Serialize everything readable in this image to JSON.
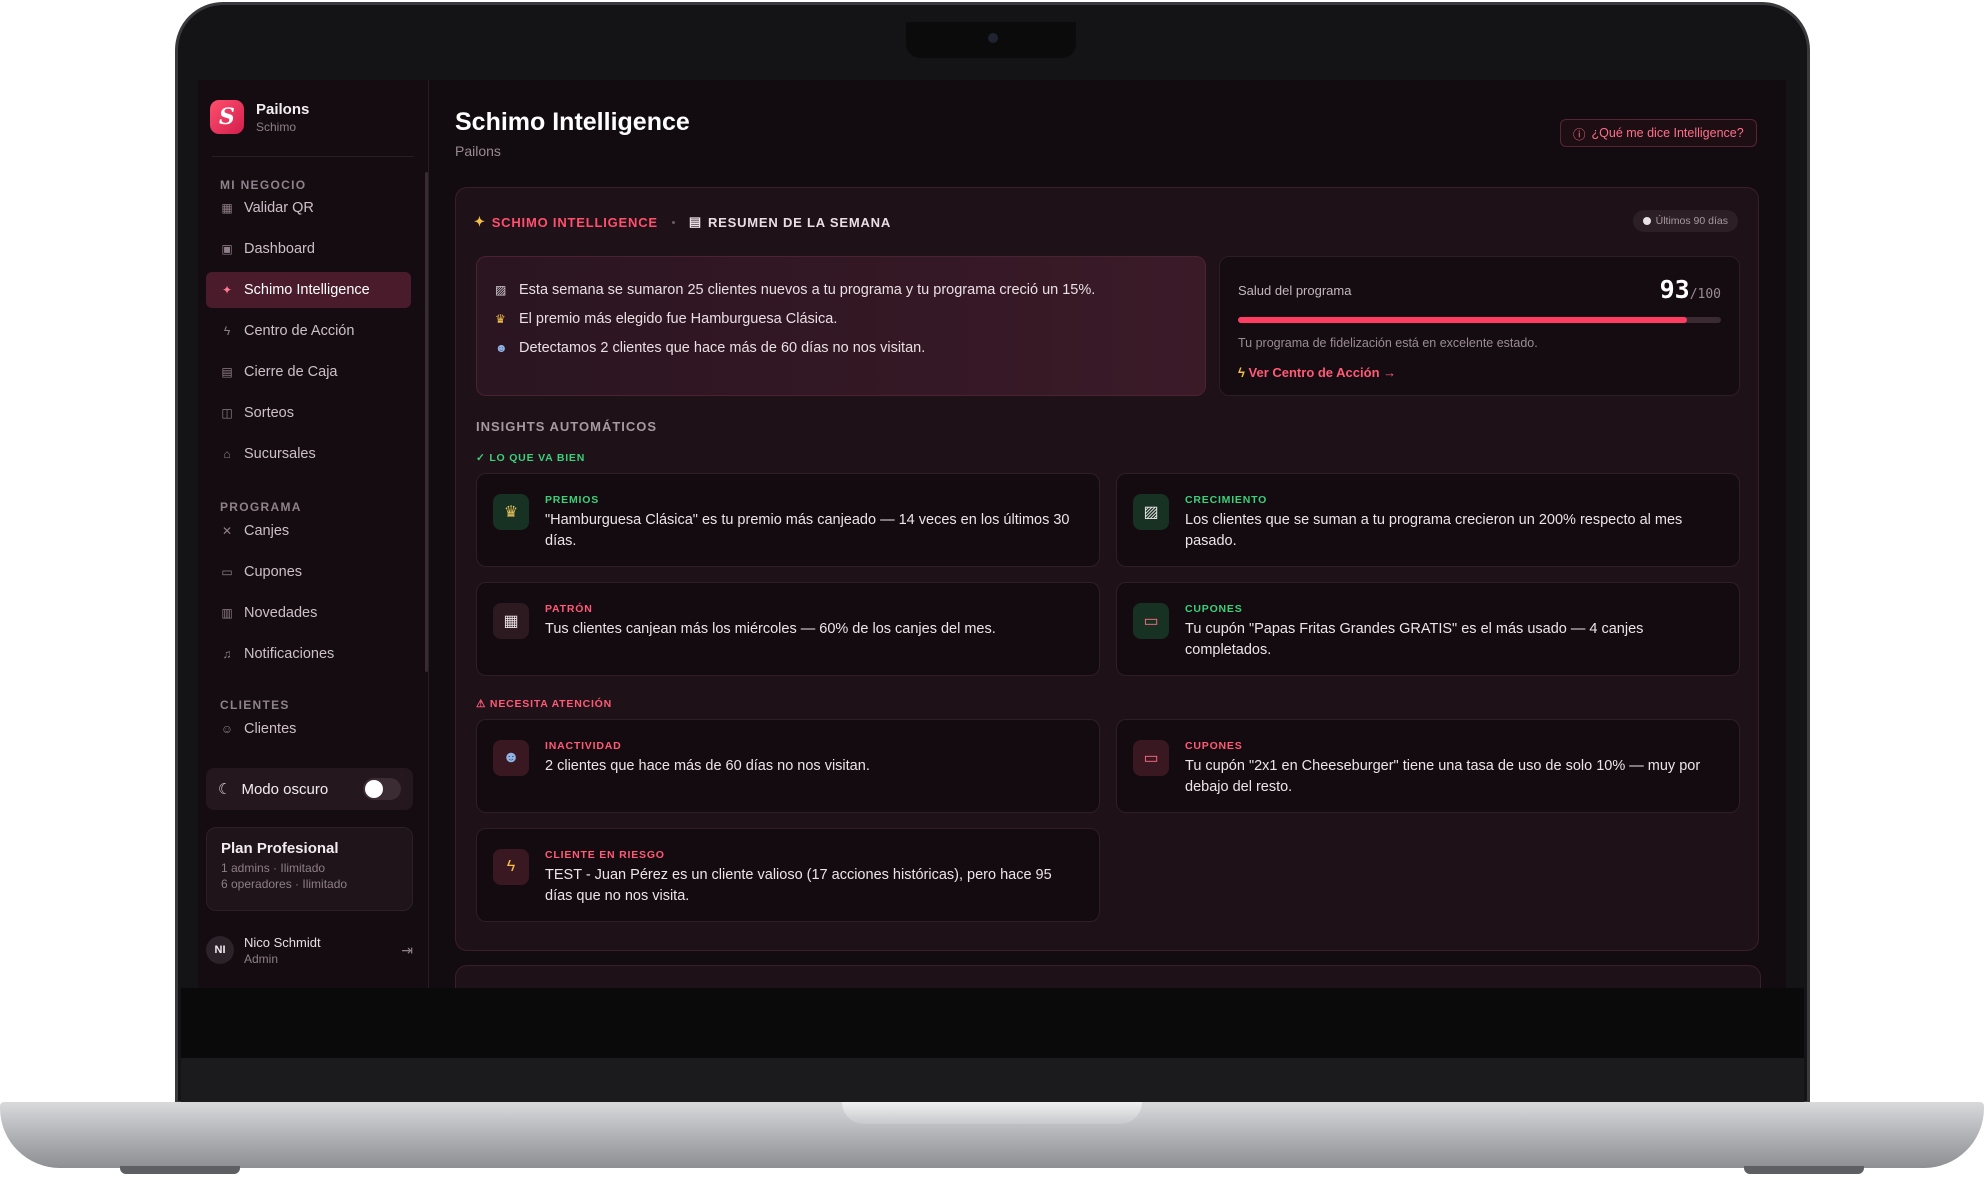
{
  "sidebar": {
    "brand_name": "Pailons",
    "brand_sub": "Schimo",
    "sections": {
      "negocio": "MI NEGOCIO",
      "programa": "PROGRAMA",
      "clientes": "CLIENTES"
    },
    "items": [
      {
        "label": "Validar QR",
        "icon": "qr-icon"
      },
      {
        "label": "Dashboard",
        "icon": "dashboard-icon"
      },
      {
        "label": "Schimo Intelligence",
        "icon": "sparkle-icon",
        "active": true
      },
      {
        "label": "Centro de Acción",
        "icon": "bolt-icon"
      },
      {
        "label": "Cierre de Caja",
        "icon": "cash-icon"
      },
      {
        "label": "Sorteos",
        "icon": "gift-icon"
      },
      {
        "label": "Sucursales",
        "icon": "store-icon"
      },
      {
        "label": "Canjes",
        "icon": "exchange-icon"
      },
      {
        "label": "Cupones",
        "icon": "ticket-icon"
      },
      {
        "label": "Novedades",
        "icon": "news-icon"
      },
      {
        "label": "Notificaciones",
        "icon": "bell-icon"
      },
      {
        "label": "Clientes",
        "icon": "users-icon"
      }
    ],
    "dark_mode_label": "Modo oscuro",
    "plan": {
      "title": "Plan Profesional",
      "line1": "1 admins · Ilimitado",
      "line2": "6 operadores · Ilimitado"
    },
    "user": {
      "initials": "NI",
      "name": "Nico Schmidt",
      "role": "Admin"
    }
  },
  "header": {
    "title": "Schimo Intelligence",
    "subtitle": "Pailons",
    "help_button": "¿Qué me dice Intelligence?"
  },
  "panel": {
    "tab_intelligence": "SCHIMO INTELLIGENCE",
    "tab_summary": "RESUMEN DE LA SEMANA",
    "period": "Últimos 90 días",
    "summary_lines": [
      "Esta semana se sumaron 25 clientes nuevos a tu programa y tu programa creció un 15%.",
      "El premio más elegido fue Hamburguesa Clásica.",
      "Detectamos 2 clientes que hace más de 60 días no nos visitan."
    ],
    "health": {
      "label": "Salud del programa",
      "score": "93",
      "max": "/100",
      "score_value": 93,
      "description": "Tu programa de fidelización está en excelente estado.",
      "link": "Ver Centro de Acción →"
    },
    "insights_title": "INSIGHTS AUTOMÁTICOS",
    "group_good": "✓ LO QUE VA BIEN",
    "group_warn": "⚠ NECESITA ATENCIÓN",
    "cards_good": [
      {
        "tag": "PREMIOS",
        "icon": "trophy-icon",
        "text": "\"Hamburguesa Clásica\" es tu premio más canjeado — 14 veces en los últimos 30 días."
      },
      {
        "tag": "CRECIMIENTO",
        "icon": "chart-icon",
        "text": "Los clientes que se suman a tu programa crecieron un 200% respecto al mes pasado."
      },
      {
        "tag": "PATRÓN",
        "icon": "calendar-icon",
        "text": "Tus clientes canjean más los miércoles — 60% de los canjes del mes."
      },
      {
        "tag": "CUPONES",
        "icon": "ticket-icon",
        "text": "Tu cupón \"Papas Fritas Grandes GRATIS\" es el más usado — 4 canjes completados."
      }
    ],
    "cards_warn": [
      {
        "tag": "INACTIVIDAD",
        "icon": "users-icon",
        "text": "2 clientes que hace más de 60 días no nos visitan."
      },
      {
        "tag": "CUPONES",
        "icon": "ticket-icon",
        "text": "Tu cupón \"2x1 en Cheeseburger\" tiene una tasa de uso de solo 10% — muy por debajo del resto."
      },
      {
        "tag": "CLIENTE EN RIESGO",
        "icon": "bolt-icon",
        "text": "TEST - Juan Pérez es un cliente valioso (17 acciones históricas), pero hace 95 días que no nos visita."
      }
    ]
  },
  "colors": {
    "accent": "#ff4f6d",
    "good": "#3bd07a",
    "background": "#120b10"
  }
}
